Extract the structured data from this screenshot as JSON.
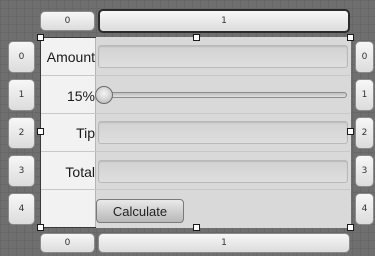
{
  "column_tabs_top": [
    "0",
    "1"
  ],
  "column_tabs_bottom": [
    "0",
    "1"
  ],
  "row_tabs_left": [
    "0",
    "1",
    "2",
    "3",
    "4"
  ],
  "row_tabs_right": [
    "0",
    "1",
    "2",
    "3",
    "4"
  ],
  "selected_column": "1",
  "form": {
    "amount_label": "Amount",
    "amount_value": "",
    "percent_label": "15%",
    "slider_fraction": 0,
    "tip_label": "Tip",
    "tip_value": "",
    "total_label": "Total",
    "total_value": "",
    "calculate_label": "Calculate"
  }
}
